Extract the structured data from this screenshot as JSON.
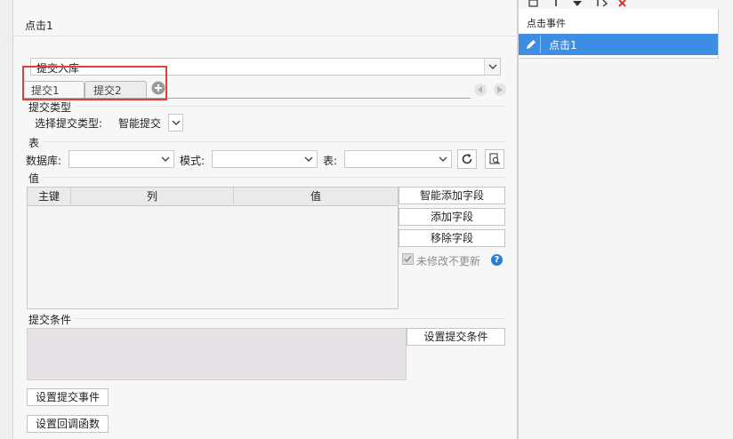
{
  "dialog": {
    "title": "点击1",
    "submit_type_dropdown": "提交入库",
    "tabs": [
      {
        "label": "提交1",
        "active": true
      },
      {
        "label": "提交2",
        "active": false
      }
    ],
    "submit_type_section": {
      "label": "提交类型",
      "select_label": "选择提交类型:",
      "select_value": "智能提交"
    },
    "table_section": {
      "label": "表",
      "database_label": "数据库:",
      "database_value": "",
      "schema_label": "模式:",
      "schema_value": "",
      "table_label": "表:",
      "table_value": ""
    },
    "value_section": {
      "label": "值",
      "columns": [
        "主键",
        "列",
        "值"
      ],
      "rows": [],
      "smart_add_label": "智能添加字段",
      "add_label": "添加字段",
      "remove_label": "移除字段",
      "unchanged_checkbox_label": "未修改不更新",
      "unchanged_checked": true
    },
    "condition_section": {
      "label": "提交条件",
      "set_label": "设置提交条件"
    },
    "set_submit_event_label": "设置提交事件",
    "set_callback_label": "设置回调函数"
  },
  "right_panel": {
    "header": "点击事件",
    "items": [
      {
        "label": "点击1",
        "selected": true
      }
    ]
  },
  "colors": {
    "accent": "#3d8ee2",
    "highlight": "#e53c3c",
    "help": "#2a7fd4"
  }
}
